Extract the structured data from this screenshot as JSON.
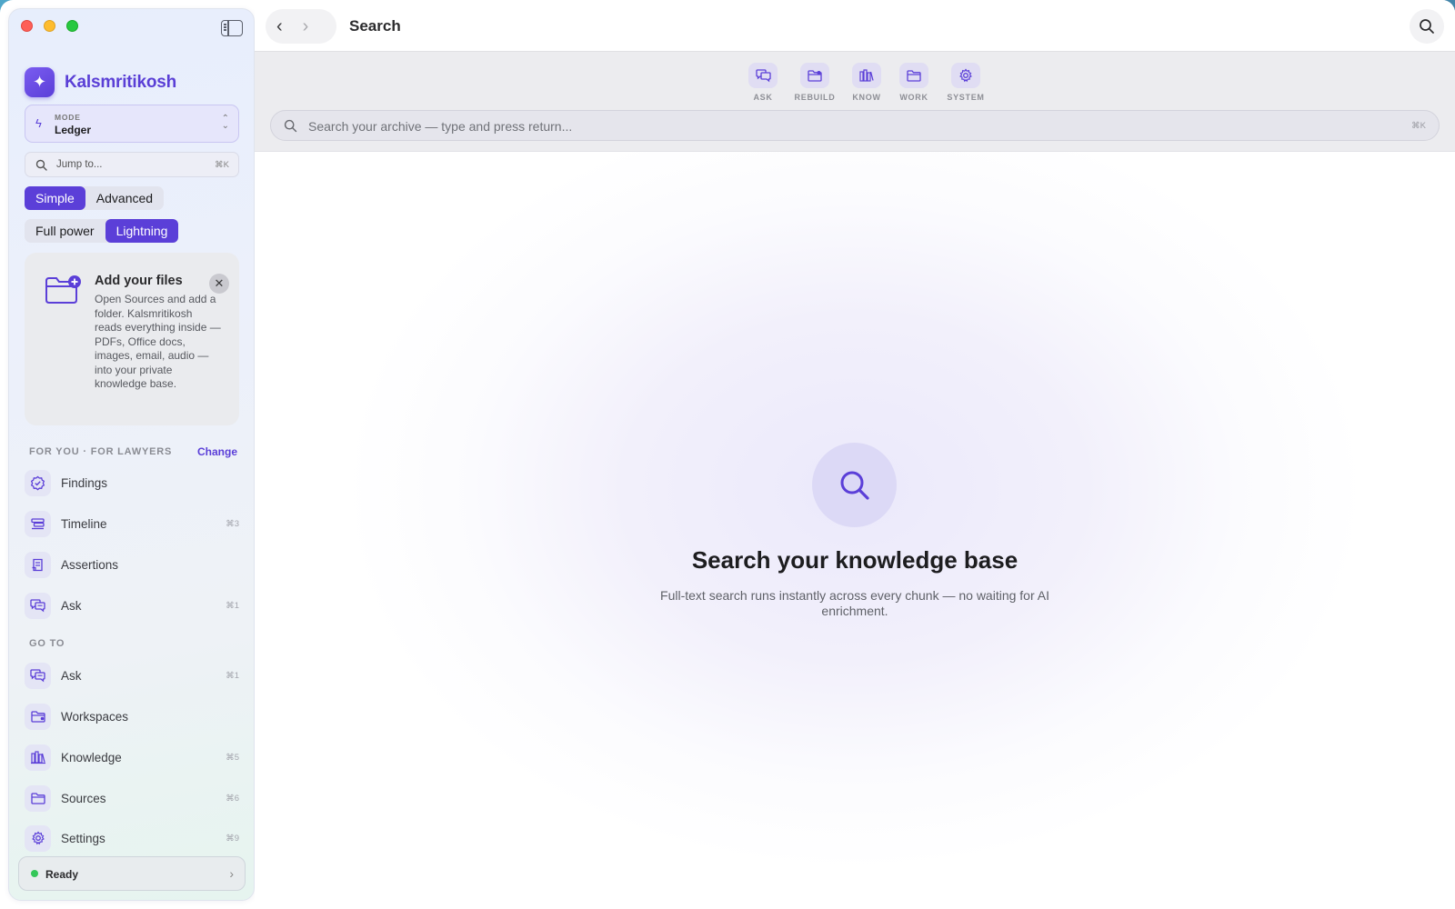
{
  "app": {
    "name": "Kalsmritikosh",
    "page_title": "Search"
  },
  "sidebar": {
    "mode": {
      "label": "MODE",
      "value": "Ledger"
    },
    "jump": {
      "placeholder": "Jump to...",
      "shortcut": "⌘K"
    },
    "complexity": {
      "options": [
        "Simple",
        "Advanced"
      ],
      "selected": "Simple"
    },
    "power": {
      "options": [
        "Full power",
        "Lightning"
      ],
      "selected": "Lightning"
    },
    "onboarding_card": {
      "title": "Add your files",
      "body": "Open Sources and add a folder. Kalsmritikosh reads everything inside — PDFs, Office docs, images, email, audio — into your private knowledge base."
    },
    "for_you": {
      "heading": "FOR YOU · FOR LAWYERS",
      "change_label": "Change",
      "items": [
        {
          "label": "Findings",
          "shortcut": "",
          "icon": "findings-icon"
        },
        {
          "label": "Timeline",
          "shortcut": "⌘3",
          "icon": "timeline-icon"
        },
        {
          "label": "Assertions",
          "shortcut": "",
          "icon": "assertions-icon"
        },
        {
          "label": "Ask",
          "shortcut": "⌘1",
          "icon": "chat-icon"
        }
      ]
    },
    "go_to": {
      "heading": "GO TO",
      "items": [
        {
          "label": "Ask",
          "shortcut": "⌘1",
          "icon": "chat-icon"
        },
        {
          "label": "Workspaces",
          "shortcut": "",
          "icon": "workspace-folder-icon"
        },
        {
          "label": "Knowledge",
          "shortcut": "⌘5",
          "icon": "books-icon"
        },
        {
          "label": "Sources",
          "shortcut": "⌘6",
          "icon": "folder-icon"
        },
        {
          "label": "Settings",
          "shortcut": "⌘9",
          "icon": "gear-icon"
        }
      ]
    },
    "status": {
      "label": "Ready",
      "color": "#34c759"
    }
  },
  "toolbar": {
    "tools": [
      {
        "label": "ASK",
        "icon": "chat-icon"
      },
      {
        "label": "REBUILD",
        "icon": "workspace-folder-icon"
      },
      {
        "label": "KNOW",
        "icon": "books-icon"
      },
      {
        "label": "WORK",
        "icon": "folder-icon"
      },
      {
        "label": "SYSTEM",
        "icon": "gear-icon"
      }
    ],
    "search": {
      "placeholder": "Search your archive — type and press return...",
      "shortcut": "⌘K"
    }
  },
  "empty_state": {
    "title": "Search your knowledge base",
    "subtitle": "Full-text search runs instantly across every chunk — no waiting for AI enrichment."
  },
  "colors": {
    "accent": "#5b3fd8",
    "accent_soft": "#e4e5f5"
  }
}
